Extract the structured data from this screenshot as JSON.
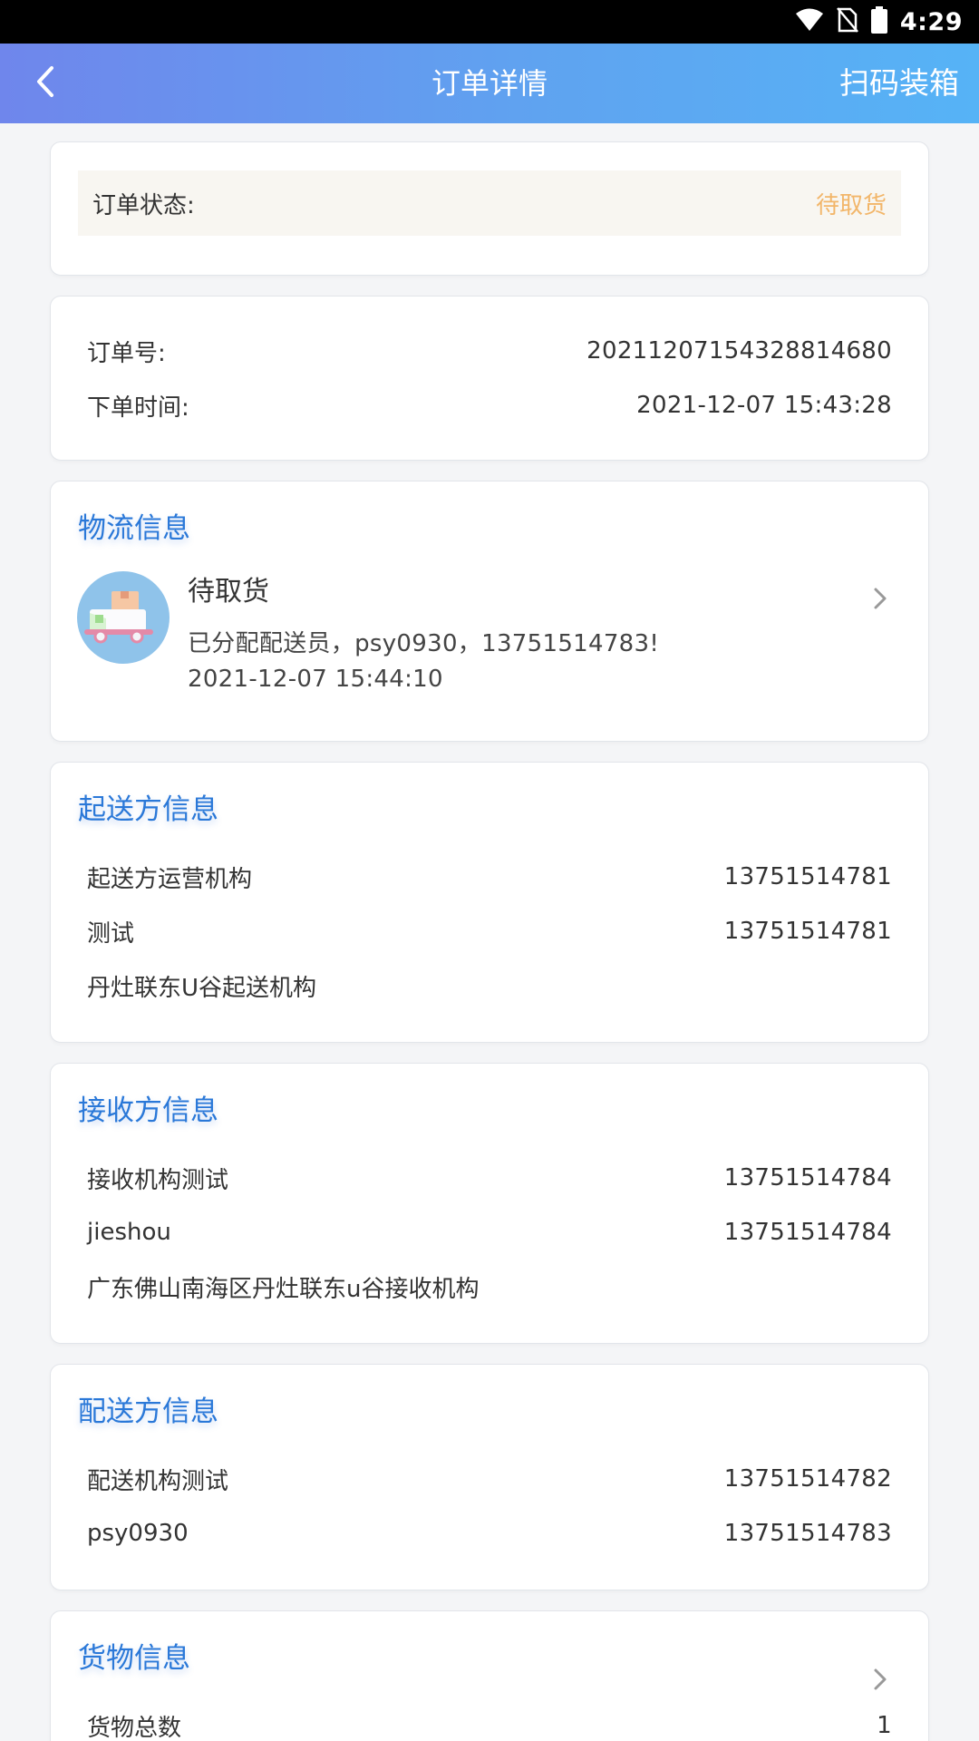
{
  "status_bar": {
    "time": "4:29"
  },
  "header": {
    "title": "订单详情",
    "action_label": "扫码装箱"
  },
  "order_status": {
    "label": "订单状态:",
    "value": "待取货",
    "value_color": "#f2b66a"
  },
  "order_info": {
    "number_label": "订单号:",
    "number_value": "20211207154328814680",
    "time_label": "下单时间:",
    "time_value": "2021-12-07 15:43:28"
  },
  "logistics": {
    "title": "物流信息",
    "status": "待取货",
    "description": "已分配配送员，psy0930，13751514783!",
    "time": "2021-12-07 15:44:10"
  },
  "sender": {
    "title": "起送方信息",
    "rows": [
      {
        "name": "起送方运营机构",
        "phone": "13751514781"
      },
      {
        "name": "测试",
        "phone": "13751514781"
      }
    ],
    "address": "丹灶联东U谷起送机构"
  },
  "receiver": {
    "title": "接收方信息",
    "rows": [
      {
        "name": "接收机构测试",
        "phone": "13751514784"
      },
      {
        "name": "jieshou",
        "phone": "13751514784"
      }
    ],
    "address": "广东佛山南海区丹灶联东u谷接收机构"
  },
  "delivery": {
    "title": "配送方信息",
    "rows": [
      {
        "name": "配送机构测试",
        "phone": "13751514782"
      },
      {
        "name": "psy0930",
        "phone": "13751514783"
      }
    ]
  },
  "goods": {
    "title": "货物信息",
    "total_label": "货物总数",
    "total_value": "1"
  },
  "colors": {
    "accent_blue": "#2a78d8",
    "pending_orange": "#f2b66a",
    "header_gradient_start": "#6f86ec",
    "header_gradient_end": "#56b3f6"
  }
}
